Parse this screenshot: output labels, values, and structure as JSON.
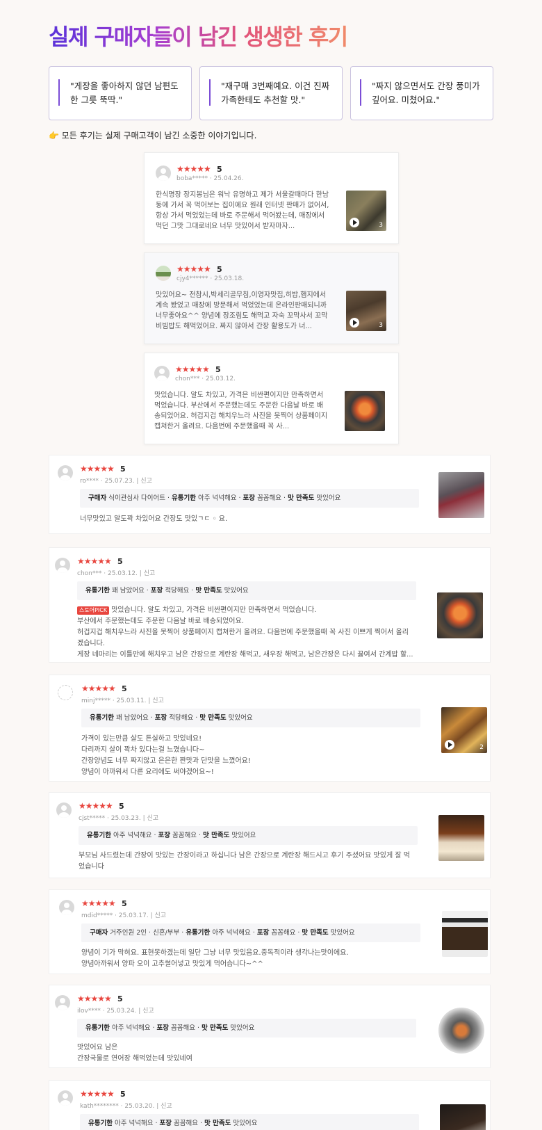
{
  "title": "실제 구매자들이 남긴 생생한 후기",
  "quotes": [
    "\"게장을 좋아하지 않던 남편도 한 그릇 뚝딱.\"",
    "\"재구매 3번째예요. 이건 진짜 가족한테도 추천할 맛.\"",
    "\"짜지 않으면서도 간장 풍미가 깊어요. 미쳤어요.\""
  ],
  "note": "👉 모든 후기는 실제 구매고객이 남긴 소중한 이야기입니다.",
  "stars": "★★★★★",
  "score": "5",
  "report": "신고",
  "cards": [
    {
      "user": "boba*****",
      "date": "25.04.26.",
      "text": "한식명장 장지봉님은 워낙 유명하고 제가 서울갈때마다 한남동에 가서 꼭 먹어보는 집이에요 원래 인터넷 판매가 없어서, 항상 가서 먹었었는데 바로 주문해서 먹어봤는데, 매장에서 먹던 그맛 그대로네요 너무 맛있어서 받자마자...",
      "thumb_count": "3"
    },
    {
      "user": "cjy4******",
      "date": "25.03.18.",
      "text": "맛있어요~ 전참시,박세리골무침,이영자맛집,히밥,햄지에서 계속 봤었고 매장에 방문해서 먹었었는데 온라인판매되니까 너무좋아요^^ 양념에 장조림도 해먹고 자숙 꼬막사서 꼬막비빔밥도 해먹었어요. 짜지 않아서 간장 활용도가 너...",
      "thumb_count": "3"
    },
    {
      "user": "chon***",
      "date": "25.03.12.",
      "text": "맛있습니다. 알도 차있고, 가격은 비싼편이지만 만족하면서 먹었습니다. 부산에서 주문했는데도 주문한 다음날 바로 배송되었어요. 허겁지겁 해치우느라 사진을 못찍어 상품페이지 캡쳐한거 올려요. 다음번에 주문했을때 꼭 사..."
    }
  ],
  "rows": [
    {
      "user": "ro****",
      "date": "25.07.23.",
      "tags": [
        {
          "k": "구매자",
          "v": "식이관심사 다이어트"
        },
        {
          "k": "유통기한",
          "v": "아주 넉넉해요"
        },
        {
          "k": "포장",
          "v": "꼼꼼해요"
        },
        {
          "k": "맛 만족도",
          "v": "맛있어요"
        }
      ],
      "lines": [
        "너무맛있고 알도꽉 차있어요 간장도 맛있ㄱㄷ ◦ 요."
      ]
    },
    {
      "user": "chon***",
      "date": "25.03.12.",
      "pick": "스토어PICK",
      "tags": [
        {
          "k": "유통기한",
          "v": "꽤 남았어요"
        },
        {
          "k": "포장",
          "v": "적당해요"
        },
        {
          "k": "맛 만족도",
          "v": "맛있어요"
        }
      ],
      "lines": [
        "맛있습니다. 알도 차있고, 가격은 비싼편이지만 만족하면서 먹었습니다.",
        "부산에서 주문했는데도 주문한 다음날 바로 배송되었어요.",
        "허겁지겁 해치우느라 사진을 못찍어 상품페이지 캡쳐한거 올려요. 다음번에 주문했을때 꼭 사진 이쁘게 찍어서 올리",
        "겠습니다.",
        "게장 네마리는 이틀만에 해치우고 남은 간장으로 계란장 해먹고, 새우장 해먹고, 남은간장은 다시 끓여서 간계밥 할..."
      ]
    },
    {
      "user": "minj*****",
      "date": "25.03.11.",
      "thumb_count": "2",
      "tags": [
        {
          "k": "유통기한",
          "v": "꽤 남았어요"
        },
        {
          "k": "포장",
          "v": "적당해요"
        },
        {
          "k": "맛 만족도",
          "v": "맛있어요"
        }
      ],
      "lines": [
        "가격이 있는만큼 살도 튼실하고 맛있네요!",
        "다리까지 살이 꽉차 있다는걸 느꼈습니다~",
        "간장양념도 너무 짜지않고 은은한 짠맛과 단맛을 느꼈어요!",
        "양념이 아까워서 다른 요리에도 써야겠어요~!"
      ]
    },
    {
      "user": "cjst*****",
      "date": "25.03.23.",
      "tags": [
        {
          "k": "유통기한",
          "v": "아주 넉넉해요"
        },
        {
          "k": "포장",
          "v": "꼼꼼해요"
        },
        {
          "k": "맛 만족도",
          "v": "맛있어요"
        }
      ],
      "lines": [
        "부모님 사드렸는데 간장이 맛있는 간장이라고 하십니다 남은 간장으로 계란장 해드시고 후기 주셨어요 맛있게 잘 먹",
        "었습니다"
      ]
    },
    {
      "user": "mdid*****",
      "date": "25.03.17.",
      "tags": [
        {
          "k": "구매자",
          "v": "거주인원 2인 · 신혼/부부"
        },
        {
          "k": "유통기한",
          "v": "아주 넉넉해요"
        },
        {
          "k": "포장",
          "v": "꼼꼼해요"
        },
        {
          "k": "맛 만족도",
          "v": "맛있어요"
        }
      ],
      "lines": [
        "양념이 기가 막혀요. 표현못하겠는데 일단 그냥 너무 맛있음요.중독적이라 생각나는맛이에요.",
        "양념아까워서 양파 오이 고추썰어넣고 맛있게 먹어습니다~^^"
      ]
    },
    {
      "user": "ilov****",
      "date": "25.03.24.",
      "tags": [
        {
          "k": "유통기한",
          "v": "아주 넉넉해요"
        },
        {
          "k": "포장",
          "v": "꼼꼼해요"
        },
        {
          "k": "맛 만족도",
          "v": "맛있어요"
        }
      ],
      "lines": [
        "맛있어요 남은",
        "간장국물로 연어장 해먹었는데 맛있네여"
      ]
    },
    {
      "user": "kath********",
      "date": "25.03.20.",
      "tags": [
        {
          "k": "유통기한",
          "v": "아주 넉넉해요"
        },
        {
          "k": "포장",
          "v": "꼼꼼해요"
        },
        {
          "k": "맛 만족도",
          "v": "맛있어요"
        }
      ],
      "lines": []
    }
  ]
}
